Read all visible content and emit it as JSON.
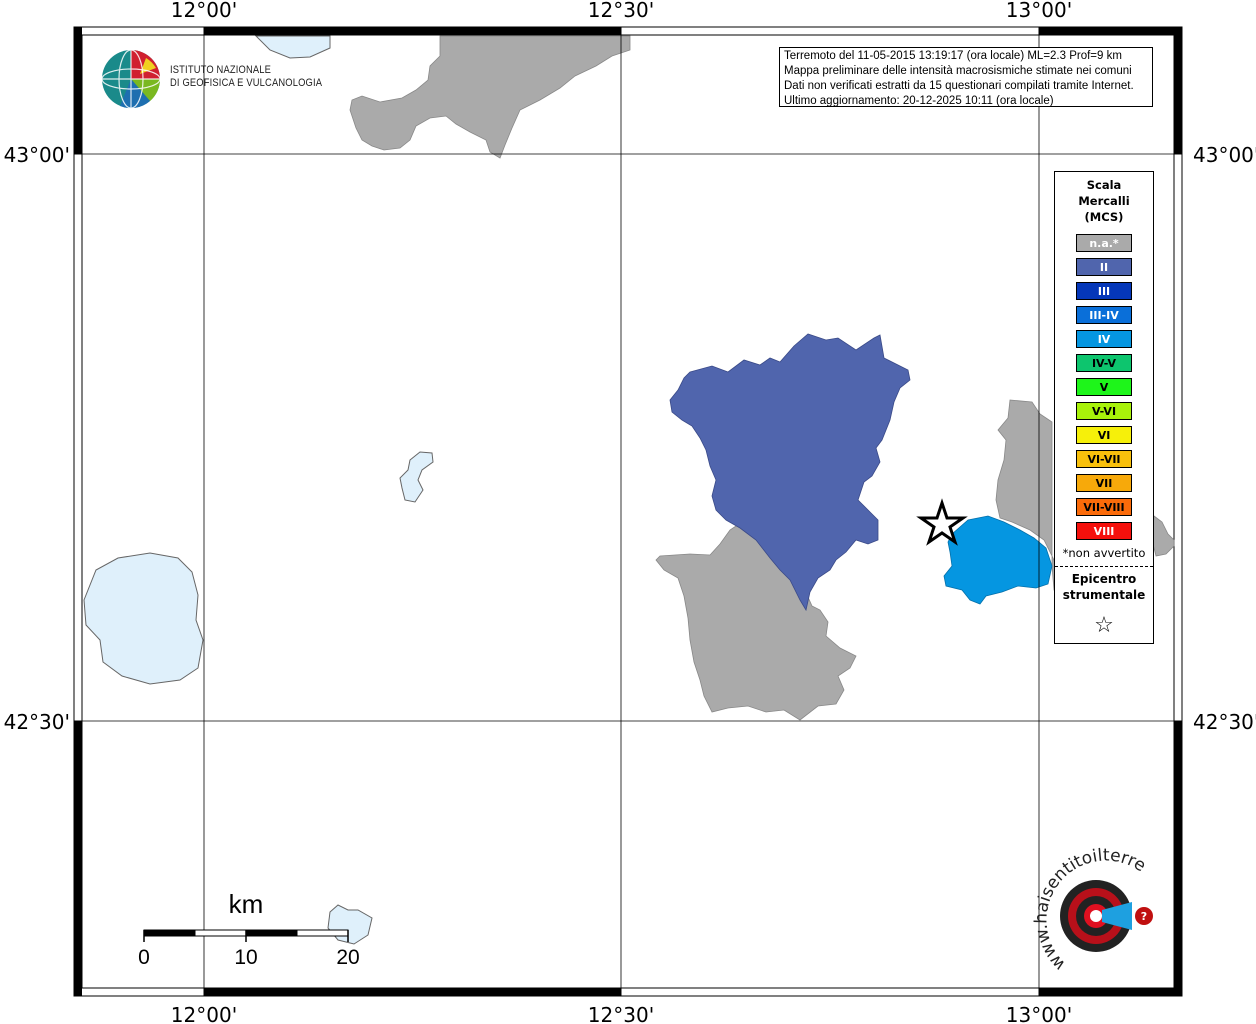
{
  "map": {
    "axis_labels": {
      "lon_top": [
        "12°00'",
        "12°30'",
        "13°00'"
      ],
      "lon_bottom": [
        "12°00'",
        "12°30'",
        "13°00'"
      ],
      "lat_left": [
        "43°00'",
        "42°30'"
      ],
      "lat_right": [
        "43°00'",
        "42°30'"
      ]
    },
    "colors": {
      "water": "#dff0fb",
      "not_available": "#aaaaaa",
      "intensity_II": "#5065ad",
      "intensity_IV": "#0596e1"
    }
  },
  "info": {
    "line1": "Terremoto del 11-05-2015 13:19:17 (ora locale) ML=2.3 Prof=9 km",
    "line2": "Mappa preliminare delle intensità macrosismiche stimate nei comuni",
    "line3": "Dati non verificati estratti da 15 questionari compilati tramite Internet.",
    "line4": "Ultimo aggiornamento: 20-12-2025 10:11 (ora locale)"
  },
  "logo": {
    "line1": "ISTITUTO NAZIONALE",
    "line2": "DI GEOFISICA E VULCANOLOGIA",
    "hsit_text": "www.haisentitoilterremoto.it"
  },
  "legend": {
    "title_1": "Scala",
    "title_2": "Mercalli",
    "title_3": "(MCS)",
    "items": [
      {
        "label": "n.a.*",
        "color": "#aaaaaa",
        "text_color": "#ffffff"
      },
      {
        "label": "II",
        "color": "#5065ad",
        "text_color": "#ffffff"
      },
      {
        "label": "III",
        "color": "#0537b9",
        "text_color": "#ffffff"
      },
      {
        "label": "III-IV",
        "color": "#0a6fd9",
        "text_color": "#ffffff"
      },
      {
        "label": "IV",
        "color": "#0596e1",
        "text_color": "#ffffff"
      },
      {
        "label": "IV-V",
        "color": "#0dc56e",
        "text_color": "#000000"
      },
      {
        "label": "V",
        "color": "#1ef51a",
        "text_color": "#000000"
      },
      {
        "label": "V-VI",
        "color": "#a8f20a",
        "text_color": "#000000"
      },
      {
        "label": "VI",
        "color": "#f6f00a",
        "text_color": "#000000"
      },
      {
        "label": "VI-VII",
        "color": "#f8c00c",
        "text_color": "#000000"
      },
      {
        "label": "VII",
        "color": "#f7a90a",
        "text_color": "#000000"
      },
      {
        "label": "VII-VIII",
        "color": "#fb6b0a",
        "text_color": "#000000"
      },
      {
        "label": "VIII",
        "color": "#f5100c",
        "text_color": "#ffffff"
      }
    ],
    "note": "*non avvertito",
    "epicenter_1": "Epicentro",
    "epicenter_2": "strumentale",
    "epicenter_symbol": "☆"
  },
  "scalebar": {
    "unit": "km",
    "ticks": [
      "0",
      "10",
      "20"
    ]
  }
}
